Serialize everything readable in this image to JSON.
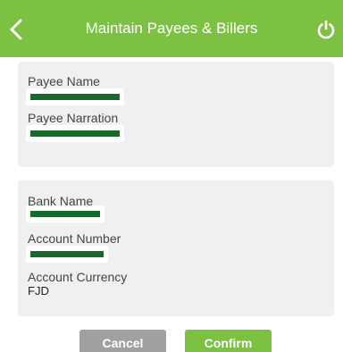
{
  "header": {
    "title": "Maintain Payees & Billers",
    "back_icon": "chevron-left-icon",
    "power_icon": "power-icon",
    "color": "#7dc142"
  },
  "payee_card": {
    "payee_name_label": "Payee Name",
    "payee_narration_label": "Payee Narration"
  },
  "bank_card": {
    "bank_name_label": "Bank Name",
    "account_number_label": "Account Number",
    "account_currency_label": "Account Currency",
    "account_currency_value": "FJD"
  },
  "actions": {
    "cancel_label": "Cancel",
    "confirm_label": "Confirm"
  }
}
